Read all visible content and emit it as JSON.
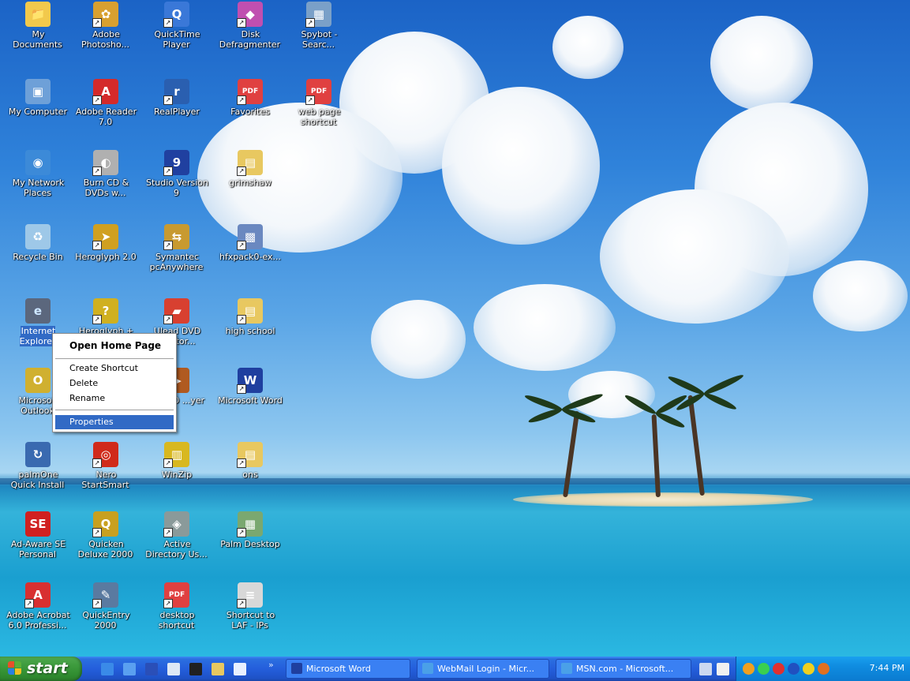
{
  "desktop": {
    "icons": [
      {
        "label": "My Documents",
        "name": "my-documents-icon",
        "color": "#f2c94c",
        "glyph": "📁",
        "shortcut": false
      },
      {
        "label": "Adobe Photosho...",
        "name": "adobe-photoshop-icon",
        "color": "#d8a030",
        "glyph": "✿",
        "shortcut": true
      },
      {
        "label": "QuickTime Player",
        "name": "quicktime-player-icon",
        "color": "#3a78d8",
        "glyph": "Q",
        "shortcut": true
      },
      {
        "label": "Disk Defragmenter",
        "name": "disk-defragmenter-icon",
        "color": "#c04fb0",
        "glyph": "◆",
        "shortcut": true
      },
      {
        "label": "Spybot - Searc...",
        "name": "spybot-icon",
        "color": "#7aa0c8",
        "glyph": "▦",
        "shortcut": true
      },
      {
        "label": "My Computer",
        "name": "my-computer-icon",
        "color": "#6ea0d8",
        "glyph": "▣",
        "shortcut": false
      },
      {
        "label": "Adobe Reader 7.0",
        "name": "adobe-reader-icon",
        "color": "#d42a2a",
        "glyph": "A",
        "shortcut": true
      },
      {
        "label": "RealPlayer",
        "name": "realplayer-icon",
        "color": "#2a5fb0",
        "glyph": "r",
        "shortcut": true
      },
      {
        "label": "Favorites",
        "name": "favorites-pdf-icon",
        "color": "#e04040",
        "glyph": "PDF",
        "shortcut": true
      },
      {
        "label": "web page shortcut",
        "name": "web-page-shortcut-pdf-icon",
        "color": "#e04040",
        "glyph": "PDF",
        "shortcut": true
      },
      {
        "label": "My Network Places",
        "name": "my-network-places-icon",
        "color": "#3c8ad8",
        "glyph": "◉",
        "shortcut": false
      },
      {
        "label": "Burn CD & DVDs w...",
        "name": "burn-cd-icon",
        "color": "#b0b0b0",
        "glyph": "◐",
        "shortcut": true
      },
      {
        "label": "Studio Version 9",
        "name": "studio-version-9-icon",
        "color": "#2040a0",
        "glyph": "9",
        "shortcut": true
      },
      {
        "label": "grimshaw",
        "name": "grimshaw-folder-icon",
        "color": "#e8c860",
        "glyph": "▤",
        "shortcut": true
      },
      {
        "label": "Recycle Bin",
        "name": "recycle-bin-icon",
        "color": "#9ec8e8",
        "glyph": "♻",
        "shortcut": false
      },
      {
        "label": "Heroglyph 2.0",
        "name": "heroglyph-icon",
        "color": "#d0a020",
        "glyph": "➤",
        "shortcut": true
      },
      {
        "label": "Symantec pcAnywhere",
        "name": "symantec-pcanywhere-icon",
        "color": "#c89a30",
        "glyph": "⇆",
        "shortcut": true
      },
      {
        "label": "hfxpack0-ex...",
        "name": "hfxpack-icon",
        "color": "#6a88c0",
        "glyph": "▩",
        "shortcut": true
      },
      {
        "label": "Internet Explorer",
        "name": "internet-explorer-icon",
        "color": "#2a7ad8",
        "glyph": "e",
        "shortcut": false
      },
      {
        "label": "Heroglyph + ...",
        "name": "heroglyph-plus-icon",
        "color": "#d0b020",
        "glyph": "?",
        "shortcut": true
      },
      {
        "label": "Ulead DVD ...actor...",
        "name": "ulead-dvd-icon",
        "color": "#d84030",
        "glyph": "▰",
        "shortcut": true
      },
      {
        "label": "high school",
        "name": "high-school-folder-icon",
        "color": "#e8c860",
        "glyph": "▤",
        "shortcut": true
      },
      {
        "label": "Microsoft Outlook",
        "name": "microsoft-outlook-icon",
        "color": "#d0b030",
        "glyph": "O",
        "shortcut": false
      },
      {
        "label": "... DVD ...yer",
        "name": "dvd-player-icon",
        "color": "#b05a20",
        "glyph": "▶",
        "shortcut": true
      },
      {
        "label": "Microsoft Word",
        "name": "microsoft-word-icon",
        "color": "#1f3f9f",
        "glyph": "W",
        "shortcut": true
      },
      {
        "label": "palmOne Quick Install",
        "name": "palmone-quick-install-icon",
        "color": "#3a6ab0",
        "glyph": "↻",
        "shortcut": false
      },
      {
        "label": "Nero StartSmart",
        "name": "nero-startsmart-icon",
        "color": "#d02a1a",
        "glyph": "◎",
        "shortcut": true
      },
      {
        "label": "WinZip",
        "name": "winzip-icon",
        "color": "#d8b820",
        "glyph": "▥",
        "shortcut": true
      },
      {
        "label": "ons",
        "name": "ons-folder-icon",
        "color": "#e8c860",
        "glyph": "▤",
        "shortcut": true
      },
      {
        "label": "Ad-Aware SE Personal",
        "name": "ad-aware-icon",
        "color": "#d02020",
        "glyph": "SE",
        "shortcut": false
      },
      {
        "label": "Quicken Deluxe 2000",
        "name": "quicken-deluxe-icon",
        "color": "#c8a020",
        "glyph": "Q",
        "shortcut": true
      },
      {
        "label": "Active Directory Us...",
        "name": "active-directory-icon",
        "color": "#8a9a9a",
        "glyph": "◈",
        "shortcut": true
      },
      {
        "label": "Palm Desktop",
        "name": "palm-desktop-icon",
        "color": "#7aa870",
        "glyph": "▦",
        "shortcut": true
      },
      {
        "label": "Adobe Acrobat 6.0 Professi...",
        "name": "adobe-acrobat-icon",
        "color": "#d83030",
        "glyph": "A",
        "shortcut": true
      },
      {
        "label": "QuickEntry 2000",
        "name": "quickentry-icon",
        "color": "#5a7aa0",
        "glyph": "✎",
        "shortcut": true
      },
      {
        "label": "desktop shortcut",
        "name": "desktop-shortcut-pdf-icon",
        "color": "#e04040",
        "glyph": "PDF",
        "shortcut": true
      },
      {
        "label": "Shortcut to LAF - IPs",
        "name": "shortcut-laf-ips-icon",
        "color": "#d8d8d8",
        "glyph": "≡",
        "shortcut": true
      }
    ]
  },
  "context_menu": {
    "items": [
      {
        "label": "Open Home Page",
        "name": "menu-open-home-page"
      },
      {
        "label": "Create Shortcut",
        "name": "menu-create-shortcut"
      },
      {
        "label": "Delete",
        "name": "menu-delete"
      },
      {
        "label": "Rename",
        "name": "menu-rename"
      },
      {
        "label": "Properties",
        "name": "menu-properties"
      }
    ]
  },
  "taskbar": {
    "start_label": "start",
    "quick_launch": [
      {
        "name": "quicklaunch-ie-icon",
        "color": "#3a8ae8"
      },
      {
        "name": "quicklaunch-ie2-icon",
        "color": "#5aa0f0"
      },
      {
        "name": "quicklaunch-word-icon",
        "color": "#2a4fb8"
      },
      {
        "name": "quicklaunch-notepad-icon",
        "color": "#dde8f5"
      },
      {
        "name": "quicklaunch-cmd-icon",
        "color": "#202020"
      },
      {
        "name": "quicklaunch-folder-icon",
        "color": "#e8c860"
      },
      {
        "name": "quicklaunch-document-icon",
        "color": "#e8f0ff"
      }
    ],
    "chevron": "»",
    "tasks": [
      {
        "label": "Microsoft Word",
        "name": "task-microsoft-word",
        "color": "#1f3f9f"
      },
      {
        "label": "WebMail Login - Micr...",
        "name": "task-webmail-login",
        "color": "#4aa0e8"
      },
      {
        "label": "MSN.com - Microsoft...",
        "name": "task-msn",
        "color": "#4aa0e8"
      }
    ],
    "clock": "7:44 PM",
    "tray_icons": [
      {
        "name": "tray-msn-icon",
        "color": "#f0a020"
      },
      {
        "name": "tray-network-icon",
        "color": "#3ad050"
      },
      {
        "name": "tray-antivirus-icon",
        "color": "#e03030"
      },
      {
        "name": "tray-realplayer-icon",
        "color": "#2050c0"
      },
      {
        "name": "tray-nero-icon",
        "color": "#f0d020"
      },
      {
        "name": "tray-arrow-icon",
        "color": "#e07020"
      }
    ]
  }
}
